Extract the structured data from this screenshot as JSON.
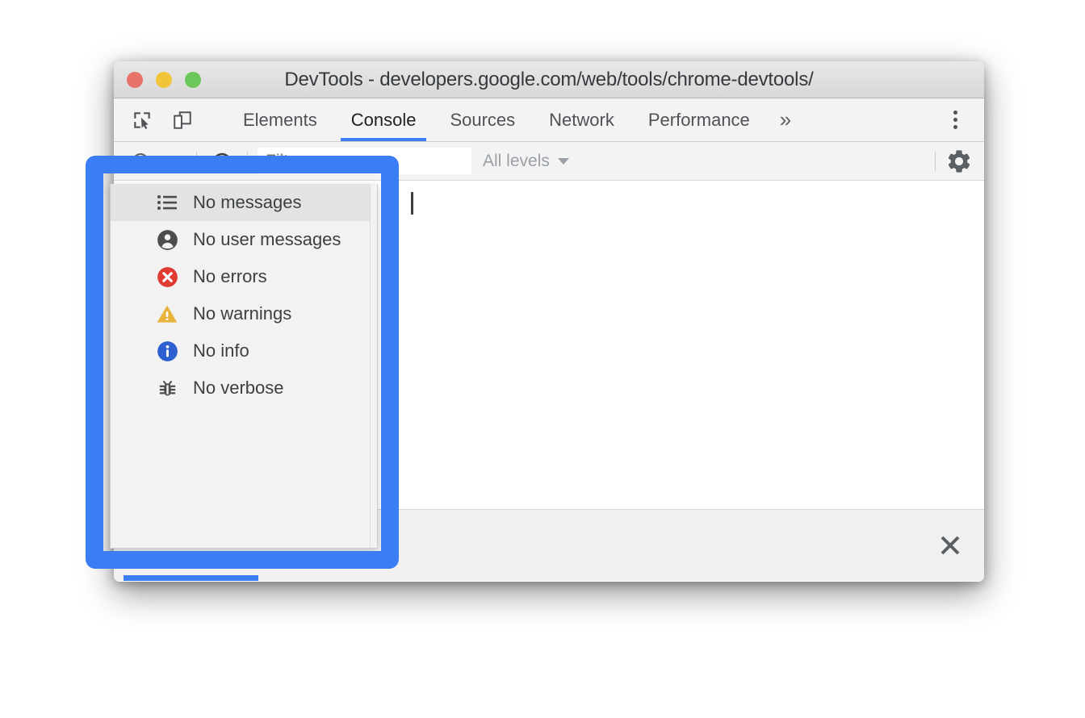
{
  "window": {
    "title": "DevTools - developers.google.com/web/tools/chrome-devtools/",
    "traffic_lights": [
      {
        "name": "close",
        "color": "#e8736a"
      },
      {
        "name": "minimize",
        "color": "#f2c438"
      },
      {
        "name": "maximize",
        "color": "#6ac75a"
      }
    ]
  },
  "tabbar": {
    "left_icons": [
      {
        "name": "inspect-element-icon"
      },
      {
        "name": "device-toolbar-icon"
      }
    ],
    "tabs": [
      {
        "label": "Elements",
        "active": false
      },
      {
        "label": "Console",
        "active": true
      },
      {
        "label": "Sources",
        "active": false
      },
      {
        "label": "Network",
        "active": false
      },
      {
        "label": "Performance",
        "active": false
      }
    ],
    "more_tabs_label": "»",
    "kebab_name": "customize-and-control-devtools"
  },
  "filterbar": {
    "context_caret_name": "execution-context-dropdown",
    "eye_icon_name": "live-expression-icon",
    "filter": {
      "value": "",
      "placeholder": "Filter"
    },
    "levels": {
      "label": "All levels"
    },
    "settings_icon_name": "settings-gear-icon"
  },
  "console": {
    "prompt_caret": true,
    "messages": []
  },
  "statusbar": {
    "close_label": "×"
  },
  "menu": {
    "name": "log-levels-menu",
    "items": [
      {
        "label": "No messages",
        "icon": "list-icon",
        "icon_color": "#4c4c4c",
        "highlighted": true
      },
      {
        "label": "No user messages",
        "icon": "person-icon",
        "icon_color": "#4c4c4c",
        "highlighted": false
      },
      {
        "label": "No errors",
        "icon": "error-icon",
        "icon_color": "#df3b30",
        "highlighted": false
      },
      {
        "label": "No warnings",
        "icon": "warning-icon",
        "icon_color": "#e8b33a",
        "highlighted": false
      },
      {
        "label": "No info",
        "icon": "info-icon",
        "icon_color": "#2d5fd0",
        "highlighted": false
      },
      {
        "label": "No verbose",
        "icon": "bug-icon",
        "icon_color": "#4c4c4c",
        "highlighted": false
      }
    ]
  },
  "annotation": {
    "highlight_color": "#3b7df5",
    "name": "highlight-rectangle"
  }
}
